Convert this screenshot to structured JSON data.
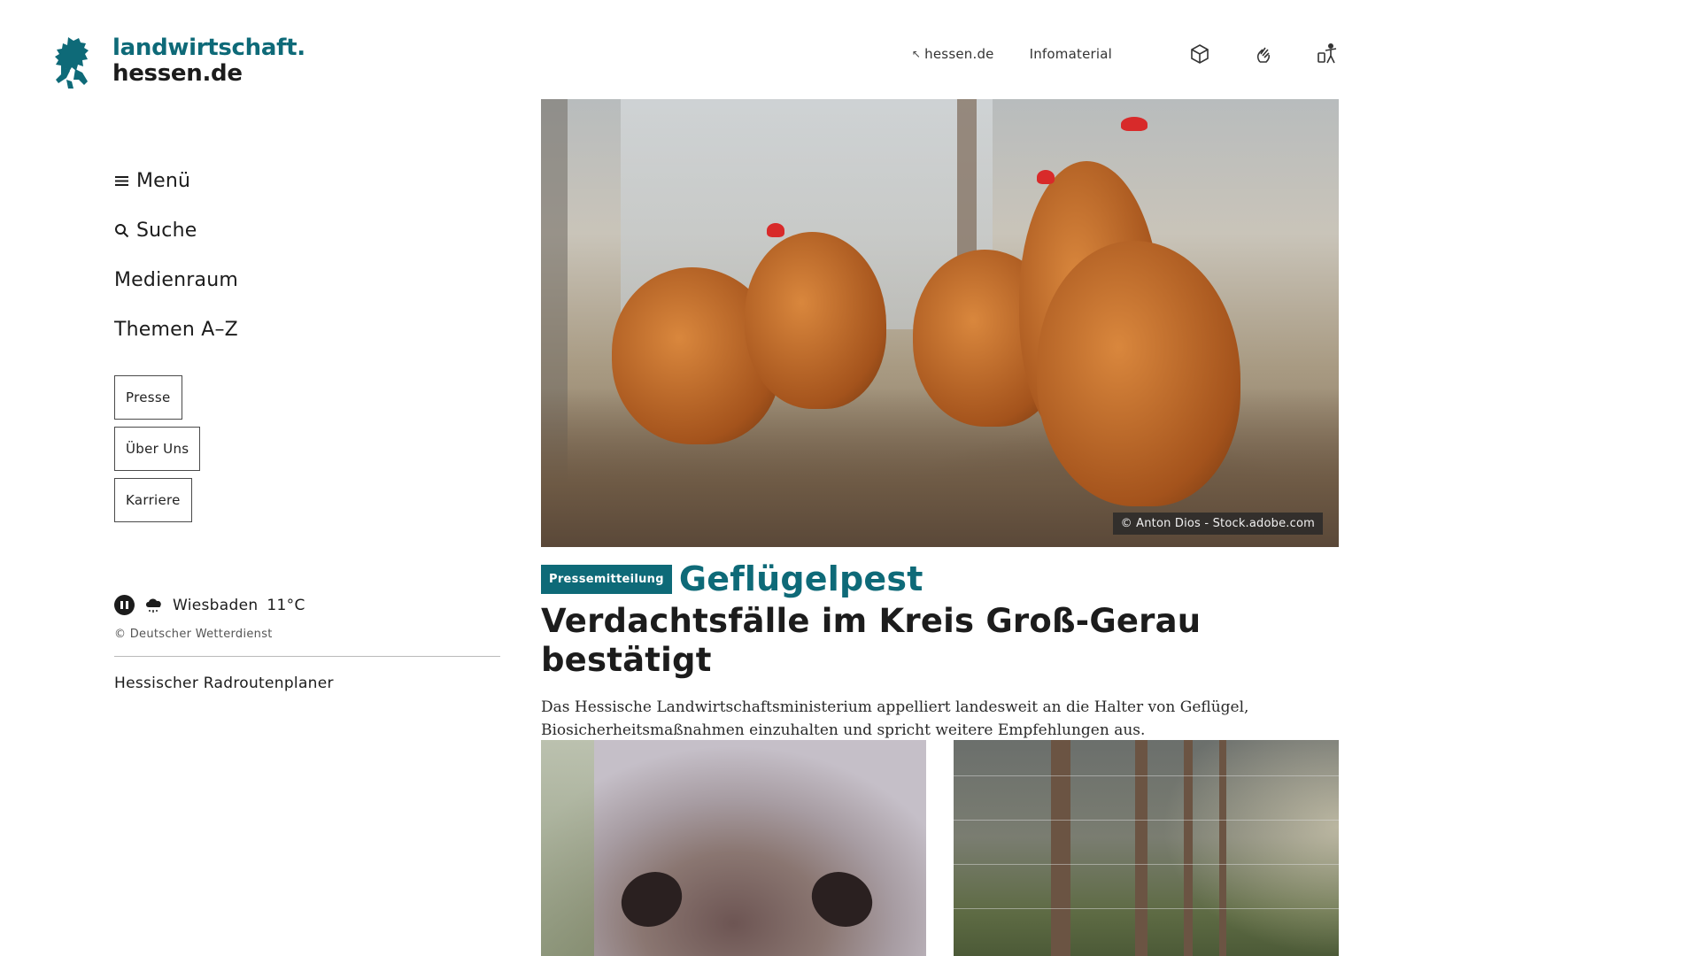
{
  "brand": {
    "line1": "landwirtschaft.",
    "line2": "hessen.de",
    "logo_icon": "hessen-lion-icon",
    "accent_color": "#0e6a78"
  },
  "topnav": {
    "hessen_link": "hessen.de",
    "infomaterial": "Infomaterial",
    "icons": [
      "easy-language-icon",
      "sign-language-icon",
      "accessibility-icon"
    ]
  },
  "sidebar": {
    "menu": "Menü",
    "search": "Suche",
    "medienraum": "Medienraum",
    "themen": "Themen A–Z",
    "buttons": [
      "Presse",
      "Über Uns",
      "Karriere"
    ],
    "weather": {
      "city": "Wiesbaden",
      "temperature": "11°C",
      "icon": "rain-cloud-icon",
      "credit": "© Deutscher Wetterdienst"
    },
    "radroutenplaner": "Hessischer Radroutenplaner"
  },
  "hero": {
    "image_credit": "© Anton Dios - Stock.adobe.com"
  },
  "teaser": {
    "badge": "Pressemitteilung",
    "kicker": "Geflügelpest",
    "headline": "Verdachtsfälle im Kreis Groß-Gerau bestätigt",
    "lead": "Das Hessische Landwirtschaftsministerium appelliert landesweit an die Halter von Geflügel, Biosicherheitsmaßnahmen einzuhalten und spricht weitere Empfehlungen aus."
  }
}
